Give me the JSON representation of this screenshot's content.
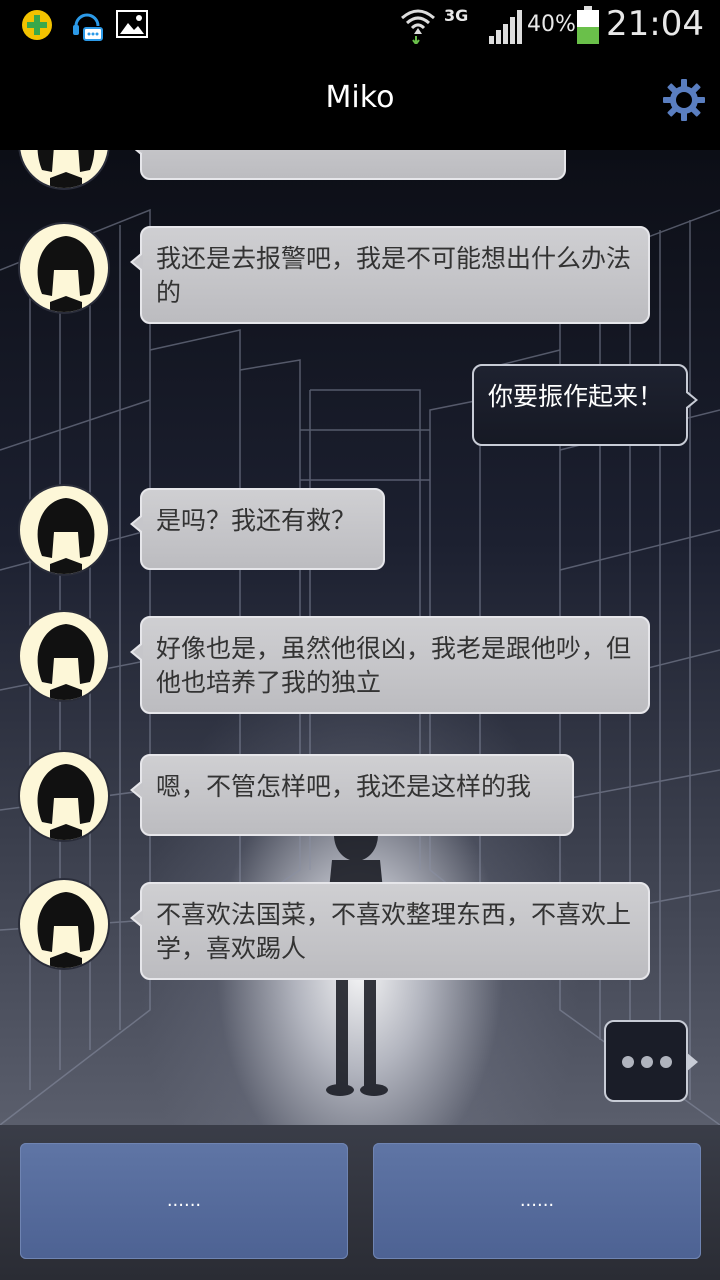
{
  "status_bar": {
    "network": "3G",
    "battery_percent": "40%",
    "time": "21:04",
    "icons": [
      "plus-app-icon",
      "headset-chat-icon",
      "gallery-icon",
      "wifi-icon",
      "signal-icon",
      "battery-icon"
    ]
  },
  "header": {
    "title": "Miko",
    "settings_icon": "gear-icon"
  },
  "messages": [
    {
      "sender": "miko",
      "text": "我还是去报警吧，我是不可能想出什么办法的"
    },
    {
      "sender": "me",
      "text": "你要振作起来！"
    },
    {
      "sender": "miko",
      "text": "是吗？我还有救？"
    },
    {
      "sender": "miko",
      "text": "好像也是，虽然他很凶，我老是跟他吵，但他也培养了我的独立"
    },
    {
      "sender": "miko",
      "text": "嗯，不管怎样吧，我还是这样的我"
    },
    {
      "sender": "miko",
      "text": "不喜欢法国菜，不喜欢整理东西，不喜欢上学，喜欢踢人"
    }
  ],
  "choices": [
    {
      "label": "......"
    },
    {
      "label": "......"
    }
  ],
  "colors": {
    "choice_button": "#5a6f9f",
    "bubble_other": "#c8c8cc",
    "bubble_me": "#1a1d28"
  }
}
